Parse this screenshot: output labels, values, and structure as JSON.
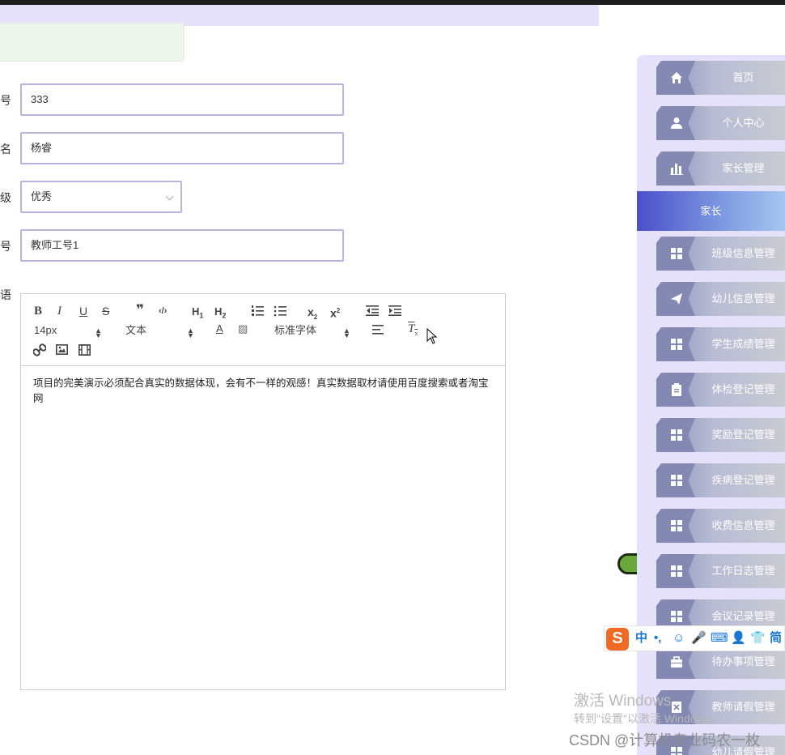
{
  "form": {
    "fields": [
      {
        "label": "号",
        "value": "333"
      },
      {
        "label": "名",
        "value": "杨睿"
      },
      {
        "label": "级",
        "value": "优秀"
      },
      {
        "label": "号",
        "value": "教师工号1"
      },
      {
        "label": "语",
        "value": ""
      }
    ]
  },
  "editor": {
    "font_size": "14px",
    "heading_select": "文本",
    "font_family_select": "标准字体",
    "content": "项目的完美演示必须配合真实的数据体现，会有不一样的观感！真实数据取材请使用百度搜索或者淘宝网",
    "tool_icons": [
      "bold-icon",
      "italic-icon",
      "underline-icon",
      "strike-icon",
      "blockquote-icon",
      "code-block-icon",
      "h1-icon",
      "h2-icon",
      "ordered-list-icon",
      "bullet-list-icon",
      "subscript-icon",
      "superscript-icon",
      "outdent-icon",
      "indent-icon",
      "font-color-icon",
      "background-color-icon",
      "align-icon",
      "clean-format-icon",
      "link-icon",
      "image-icon",
      "video-icon"
    ]
  },
  "sidebar": {
    "items": [
      {
        "label": "首页",
        "icon": "home-icon"
      },
      {
        "label": "个人中心",
        "icon": "user-icon"
      },
      {
        "label": "家长管理",
        "icon": "bar-chart-icon"
      },
      {
        "label": "家长",
        "icon": "",
        "active": true
      },
      {
        "label": "班级信息管理",
        "icon": "grid-icon"
      },
      {
        "label": "幼儿信息管理",
        "icon": "send-icon"
      },
      {
        "label": "学生成绩管理",
        "icon": "grid-icon"
      },
      {
        "label": "体检登记管理",
        "icon": "clipboard-icon"
      },
      {
        "label": "奖励登记管理",
        "icon": "grid-icon"
      },
      {
        "label": "疾病登记管理",
        "icon": "grid-icon"
      },
      {
        "label": "收费信息管理",
        "icon": "grid-icon"
      },
      {
        "label": "工作日志管理",
        "icon": "grid-icon"
      },
      {
        "label": "会议记录管理",
        "icon": "grid-icon"
      },
      {
        "label": "待办事项管理",
        "icon": "briefcase-icon"
      },
      {
        "label": "教师请假管理",
        "icon": "close-box-icon"
      },
      {
        "label": "幼儿请假管理",
        "icon": "grid-icon"
      }
    ]
  },
  "ime": {
    "keys": [
      "中",
      "•,",
      "☺",
      "🎤",
      "⌨",
      "👤",
      "👕",
      "简"
    ]
  },
  "overlay": {
    "activate_title": "激活 Windows",
    "activate_sub": "转到\"设置\"以激活 Windows。",
    "csdn": "CSDN @计算机专业码农一枚"
  },
  "colors": {
    "sidebar_bg": "#e6e1fb",
    "active_item": "#4b4fc9",
    "input_border": "#b7b4e0"
  }
}
